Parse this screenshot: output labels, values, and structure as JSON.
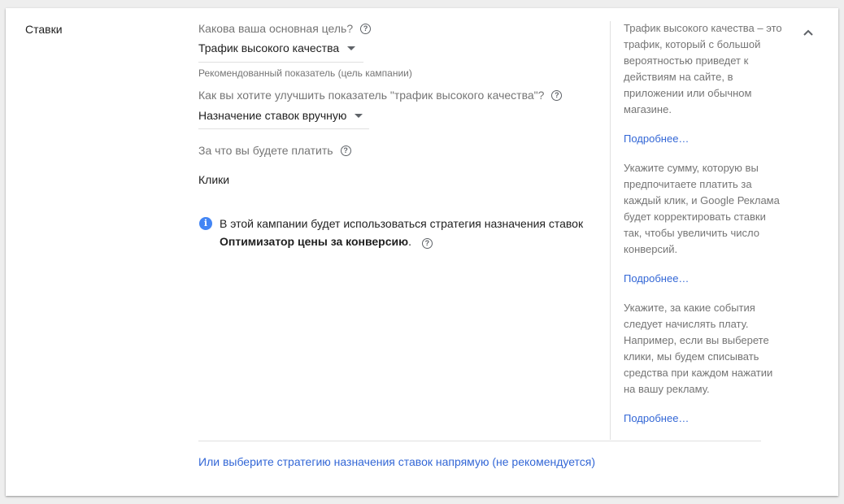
{
  "section": {
    "title": "Ставки"
  },
  "goal": {
    "question": "Какова ваша основная цель?",
    "selected": "Трафик высокого качества",
    "hint": "Рекомендованный показатель (цель кампании)"
  },
  "improve": {
    "question": "Как вы хотите улучшить показатель \"трафик высокого качества\"?",
    "selected": "Назначение ставок вручную"
  },
  "pay": {
    "question": "За что вы будете платить",
    "value": "Клики"
  },
  "info": {
    "text": "В этой кампании будет использоваться стратегия назначения ставок",
    "strategy": "Оптимизатор цены за конверсию",
    "suffix": "."
  },
  "sidebar": {
    "help1": "Трафик высокого качества – это трафик, который с большой вероятностью приведет к действиям на сайте, в приложении или обычном магазине.",
    "help2": "Укажите сумму, которую вы предпочитаете платить за каждый клик, и Google Реклама будет корректировать ставки так, чтобы увеличить число конверсий.",
    "help3": "Укажите, за какие события следует начислять плату. Например, если вы выберете клики, мы будем списывать средства при каждом нажатии на вашу рекламу.",
    "more_label": "Подробнее…"
  },
  "bottom_link": "Или выберите стратегию назначения ставок напрямую (не рекомендуется)",
  "colors": {
    "link": "#3367d6",
    "info": "#4285f4"
  }
}
